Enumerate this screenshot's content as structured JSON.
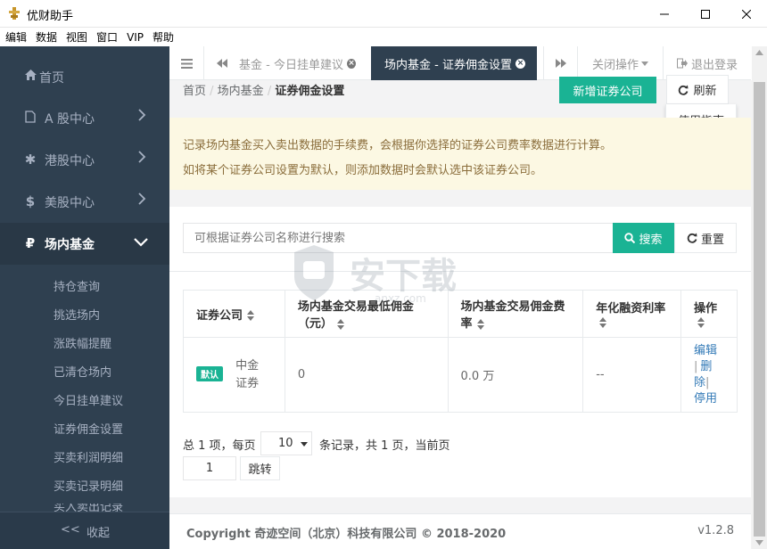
{
  "window": {
    "title": "优财助手"
  },
  "menu": [
    "编辑",
    "数据",
    "视图",
    "窗口",
    "VIP",
    "帮助"
  ],
  "sidebar": {
    "items": [
      {
        "label": "首页"
      },
      {
        "label": "A 股中心"
      },
      {
        "label": "港股中心"
      },
      {
        "label": "美股中心"
      },
      {
        "label": "场内基金"
      }
    ],
    "subitems": [
      "持仓查询",
      "挑选场内",
      "涨跌幅提醒",
      "已清仓场内",
      "今日挂单建议",
      "证券佣金设置",
      "买卖利润明细",
      "买卖记录明细",
      "买入卖出记录"
    ],
    "collapse": "收起",
    "collapse_icon": "<<"
  },
  "tabs": {
    "prev_tab": "基金 - 今日挂单建议",
    "active_tab": "场内基金 - 证券佣金设置",
    "close_ops": "关闭操作",
    "logout": "退出登录"
  },
  "breadcrumb": [
    "首页",
    "场内基金",
    "证券佣金设置"
  ],
  "toolbar": {
    "add": "新增证券公司",
    "refresh": "刷新",
    "guide": "使用指南"
  },
  "alert": {
    "line1": "记录场内基金买入卖出数据的手续费，会根据你选择的证券公司费率数据进行计算。",
    "line2": "如将某个证券公司设置为默认，则添加数据时会默认选中该证券公司。"
  },
  "search": {
    "placeholder": "可根据证券公司名称进行搜索",
    "search_btn": "搜索",
    "reset_btn": "重置"
  },
  "table": {
    "headers": [
      "证券公司",
      "场内基金交易最低佣金（元）",
      "场内基金交易佣金费率",
      "年化融资利率",
      "操作"
    ],
    "rows": [
      {
        "badge": "默认",
        "company": "中金证券",
        "min_commission": "0",
        "rate": "0.0 万",
        "interest": "--",
        "actions": [
          "编辑",
          "删除",
          "停用"
        ]
      }
    ]
  },
  "pagination": {
    "prefix": "总 1 项，每页",
    "page_size": "10",
    "suffix": "条记录，共 1 页，当前页",
    "current_page": "1",
    "go": "跳转"
  },
  "footer": {
    "copyright": "Copyright 奇迹空间（北京）科技有限公司 © 2018-2020",
    "version": "v1.2.8"
  }
}
